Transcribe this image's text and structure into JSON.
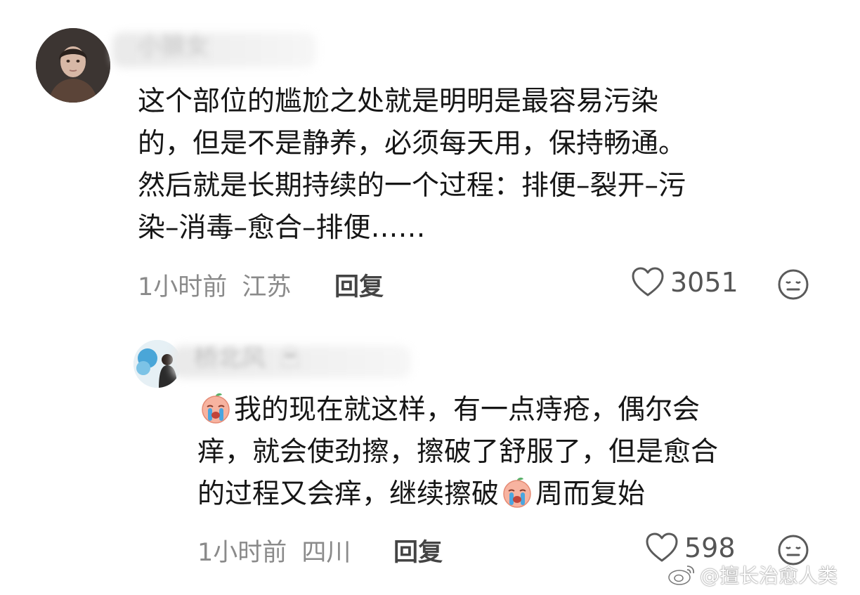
{
  "comment1": {
    "username": "小狼女",
    "text_lines": [
      "这个部位的尴尬之处就是明明是最容易污染",
      "的，但是不是静养，必须每天用，保持畅通。",
      "然后就是长期持续的一个过程：排便–裂开–污",
      "染–消毒–愈合–排便……"
    ],
    "time": "1小时前",
    "location": "江苏",
    "reply_label": "回复",
    "like_count": "3051"
  },
  "comment2": {
    "username": "桥北风",
    "text_line1": "我的现在就这样，有一点痔疮，偶尔会",
    "text_line2": "痒，就会使劲擦，擦破了舒服了，但是愈合",
    "text_line3a": "的过程又会痒，继续擦破",
    "text_line3b": "周而复始",
    "time": "1小时前",
    "location": "四川",
    "reply_label": "回复",
    "like_count": "598"
  },
  "watermark": "@擅长治愈人类",
  "icons": {
    "like": "heart-outline-icon",
    "reaction": "neutral-face-icon",
    "inline_emoji": "crying-peach-emoji",
    "username_badge": "ghost-icon",
    "watermark_logo": "weibo-logo"
  },
  "colors": {
    "text": "#161616",
    "meta": "#8a8a8a",
    "reply": "#444444",
    "emoji": "#f6a48f"
  }
}
